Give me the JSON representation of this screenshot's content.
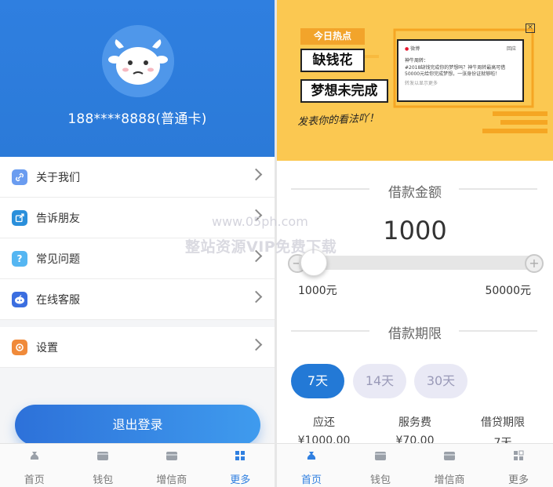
{
  "left": {
    "phone": "188****8888(普通卡)",
    "menu": [
      {
        "label": "关于我们",
        "icon": "link-icon",
        "color": "#6a9cf0"
      },
      {
        "label": "告诉朋友",
        "icon": "share-icon",
        "color": "#2a8fdb"
      },
      {
        "label": "常见问题",
        "icon": "question-icon",
        "color": "#55b6f2"
      },
      {
        "label": "在线客服",
        "icon": "chat-robot-icon",
        "color": "#3b6ee0"
      },
      {
        "label": "设置",
        "icon": "gear-icon",
        "color": "#f08a3a"
      }
    ],
    "logout_label": "退出登录",
    "tabs": [
      {
        "label": "首页",
        "icon": "money-bag-icon"
      },
      {
        "label": "钱包",
        "icon": "wallet-icon"
      },
      {
        "label": "增信商",
        "icon": "store-icon"
      },
      {
        "label": "更多",
        "icon": "grid-icon",
        "active": true
      }
    ]
  },
  "right": {
    "banner": {
      "hot_tag": "今日热点",
      "word1": "缺钱花",
      "word2": "梦想未完成",
      "slogan": "发表你的看法吖！",
      "weibo_brand": "微博",
      "weibo_follow": "回应",
      "weibo_name": "神牛周转：",
      "weibo_text": "#2018缺钱完成你的梦想吗？神牛周转最高可借50000元给你完成梦想，一张身份证就够啦！",
      "weibo_more": "转发以显示更多",
      "close": "×"
    },
    "amount_title": "借款金额",
    "amount": "1000",
    "min_label": "1000元",
    "max_label": "50000元",
    "minus": "−",
    "plus": "+",
    "term_title": "借款期限",
    "terms": [
      {
        "label": "7天",
        "active": true
      },
      {
        "label": "14天"
      },
      {
        "label": "30天"
      }
    ],
    "summary": [
      {
        "label": "应还",
        "value": "¥1000.00"
      },
      {
        "label": "服务费",
        "value": "¥70.00"
      },
      {
        "label": "借贷期限",
        "value": "7天"
      }
    ],
    "tabs": [
      {
        "label": "首页",
        "icon": "money-bag-icon",
        "active": true
      },
      {
        "label": "钱包",
        "icon": "wallet-icon"
      },
      {
        "label": "增信商",
        "icon": "store-icon"
      },
      {
        "label": "更多",
        "icon": "grid-icon"
      }
    ]
  },
  "watermark": {
    "url": "www.05ph.com",
    "text": "整站资源VIP免费下载"
  },
  "colors": {
    "primary": "#2f7fe0",
    "banner": "#fbc851",
    "chip_inactive": "#e9e9f5"
  }
}
